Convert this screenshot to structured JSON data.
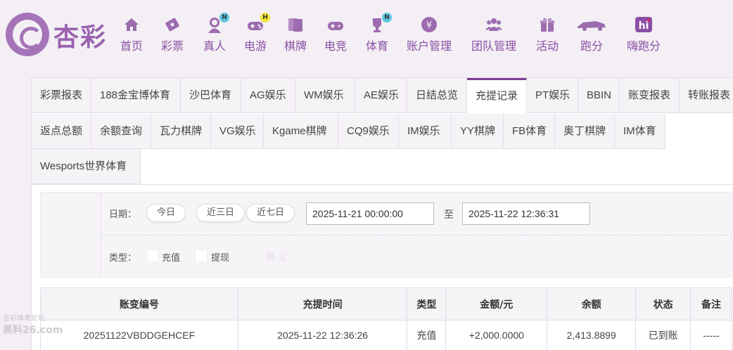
{
  "brand": {
    "logo_text": "杏彩"
  },
  "nav": [
    {
      "label": "首页",
      "icon": "home-icon",
      "badge": ""
    },
    {
      "label": "彩票",
      "icon": "lottery-ticket-icon",
      "badge": ""
    },
    {
      "label": "真人",
      "icon": "live-dealer-icon",
      "badge": "N"
    },
    {
      "label": "电游",
      "icon": "slot-gamepad-icon",
      "badge": "H"
    },
    {
      "label": "棋牌",
      "icon": "cards-icon",
      "badge": ""
    },
    {
      "label": "电竞",
      "icon": "esports-gamepad-icon",
      "badge": ""
    },
    {
      "label": "体育",
      "icon": "trophy-icon",
      "badge": "N"
    },
    {
      "label": "账户管理",
      "icon": "account-yen-icon",
      "badge": ""
    },
    {
      "label": "团队管理",
      "icon": "team-icon",
      "badge": ""
    },
    {
      "label": "活动",
      "icon": "gift-icon",
      "badge": ""
    },
    {
      "label": "跑分",
      "icon": "running-car-icon",
      "badge": ""
    },
    {
      "label": "嗨跑分",
      "icon": "hi-icon",
      "badge": ""
    }
  ],
  "tabs": [
    "彩票报表",
    "188金宝博体育",
    "沙巴体育",
    "AG娱乐",
    "WM娱乐",
    "AE娱乐",
    "日结总览",
    "充提记录",
    "PT娱乐",
    "BBIN",
    "账变报表",
    "转账报表",
    "返点总额",
    "余额查询",
    "瓦力棋牌",
    "VG娱乐",
    "Kgame棋牌",
    "CQ9娱乐",
    "IM娱乐",
    "YY棋牌",
    "FB体育",
    "奥丁棋牌",
    "IM体育",
    "Wesports世界体育"
  ],
  "active_tab": "充提记录",
  "filter": {
    "date_label": "日期：",
    "quick_ranges": [
      "今日",
      "近三日",
      "近七日"
    ],
    "start_date": "2025-11-21 00:00:00",
    "to_label": "至",
    "end_date": "2025-11-22 12:36:31",
    "type_label": "类型：",
    "type_options": [
      "充值",
      "提现"
    ],
    "confirm_label": "确 定"
  },
  "table": {
    "headers": [
      "账变编号",
      "充提时间",
      "类型",
      "金额/元",
      "余额",
      "状态",
      "备注"
    ],
    "rows": [
      [
        "20251122VBDDGEHCEF",
        "2025-11-22 12:36:26",
        "充值",
        "+2,000.0000",
        "2,413.8899",
        "已到账",
        "-----"
      ]
    ]
  },
  "watermark": {
    "line1": "杏彩体育论坛",
    "line2": "黑料26.com"
  },
  "colors": {
    "brand_purple": "#8a4fa4",
    "active_tab_border": "#7b3f93",
    "amount_red": "#d9001b",
    "status_green": "#2e9a2e"
  }
}
